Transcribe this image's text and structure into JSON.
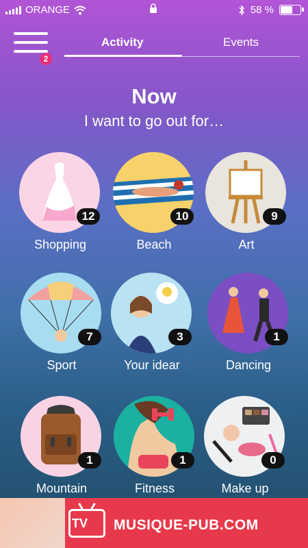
{
  "status_bar": {
    "carrier": "ORANGE",
    "battery": "58 %"
  },
  "menu": {
    "badge": "2"
  },
  "tabs": [
    {
      "label": "Activity",
      "active": true
    },
    {
      "label": "Events",
      "active": false
    }
  ],
  "hero": {
    "title": "Now",
    "subtitle": "I want to go out for…"
  },
  "categories": [
    {
      "label": "Shopping",
      "count": "12",
      "icon": "dress-icon"
    },
    {
      "label": "Beach",
      "count": "10",
      "icon": "beach-icon"
    },
    {
      "label": "Art",
      "count": "9",
      "icon": "easel-icon"
    },
    {
      "label": "Sport",
      "count": "7",
      "icon": "parachute-icon"
    },
    {
      "label": "Your idear",
      "count": "3",
      "icon": "lightbulb-idea-icon"
    },
    {
      "label": "Dancing",
      "count": "1",
      "icon": "dancing-couple-icon"
    },
    {
      "label": "Mountain",
      "count": "1",
      "icon": "backpack-icon"
    },
    {
      "label": "Fitness",
      "count": "1",
      "icon": "dumbbell-icon"
    },
    {
      "label": "Make up",
      "count": "0",
      "icon": "makeup-icon"
    }
  ],
  "ad": {
    "logo_text": "TV",
    "brand": "MUSIQUE-PUB.COM"
  },
  "colors": {
    "badge": "#e82f7a",
    "ad_bg": "#e8394c",
    "count_bg": "#111111"
  }
}
